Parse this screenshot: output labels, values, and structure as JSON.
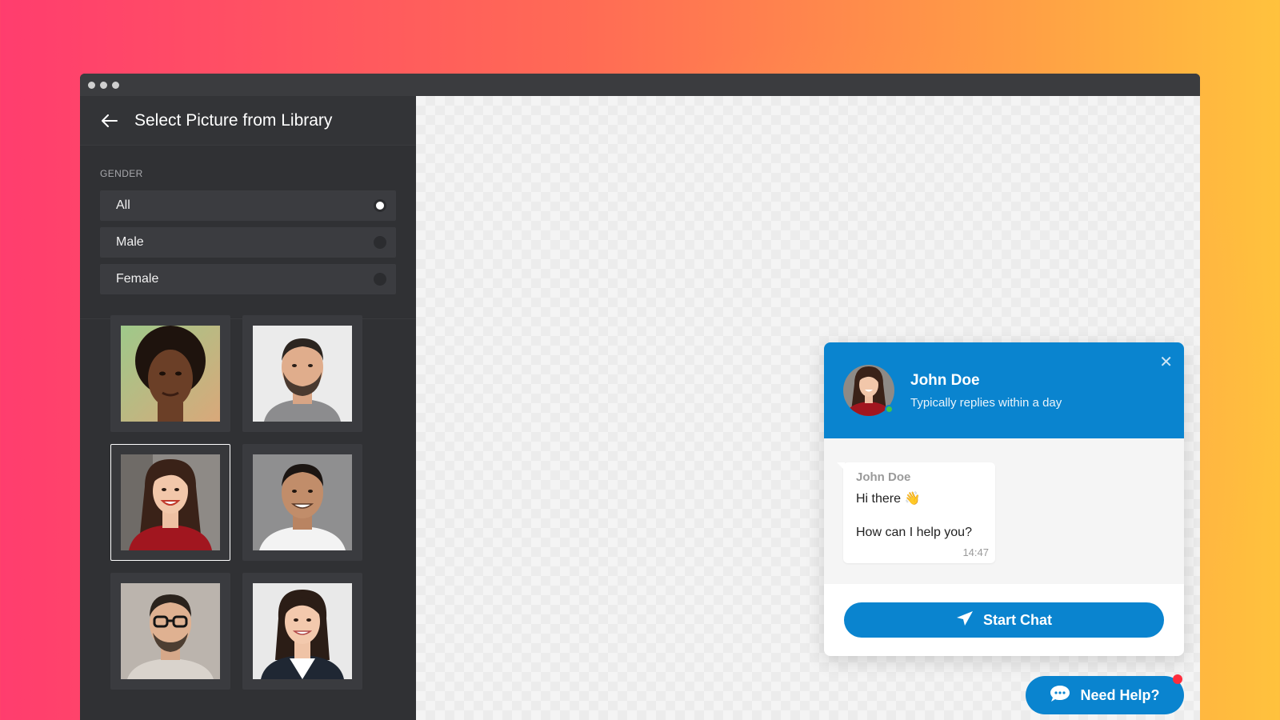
{
  "window": {
    "controls": [
      "close",
      "minimize",
      "maximize"
    ]
  },
  "sidebar": {
    "title": "Select Picture from Library",
    "back_icon": "arrow-left-icon",
    "gender": {
      "label": "GENDER",
      "options": [
        {
          "label": "All",
          "checked": true
        },
        {
          "label": "Male",
          "checked": false
        },
        {
          "label": "Female",
          "checked": false
        }
      ]
    },
    "pictures": [
      {
        "name": "avatar-woman-curly-hair",
        "selected": false
      },
      {
        "name": "avatar-man-beard",
        "selected": false
      },
      {
        "name": "avatar-woman-red-sweater",
        "selected": true
      },
      {
        "name": "avatar-man-smiling",
        "selected": false
      },
      {
        "name": "avatar-man-glasses",
        "selected": false
      },
      {
        "name": "avatar-woman-dark-hair",
        "selected": false
      }
    ]
  },
  "chat": {
    "agent_name": "John Doe",
    "status": "Typically replies within a day",
    "close_icon": "close-icon",
    "message": {
      "sender": "John Doe",
      "line1": "Hi there 👋",
      "line2": "How can I help you?",
      "time": "14:47"
    },
    "start_button": "Start Chat",
    "send_icon": "paper-plane-icon"
  },
  "help_button": {
    "label": "Need Help?",
    "icon": "chat-bubble-icon",
    "has_notification": true
  },
  "colors": {
    "accent": "#0a84cf",
    "sidebar_bg": "#303134",
    "online": "#43c64a",
    "notification": "#ff2d3d"
  }
}
